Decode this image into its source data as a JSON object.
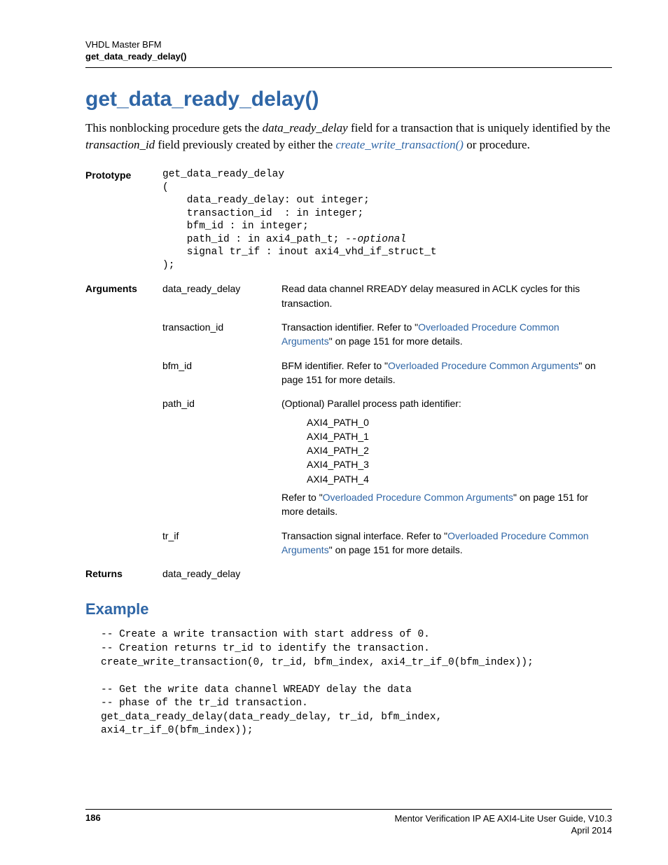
{
  "header": {
    "chapter": "VHDL Master BFM",
    "section": "get_data_ready_delay()"
  },
  "title": "get_data_ready_delay()",
  "intro": {
    "prefix": "This nonblocking procedure gets the ",
    "ital1": "data_ready_delay",
    "mid1": " field for a transaction that is uniquely identified by the ",
    "ital2": "transaction_id",
    "mid2": " field previously created by either the ",
    "link": "create_write_transaction()",
    "suffix": " or  procedure."
  },
  "labels": {
    "prototype": "Prototype",
    "arguments": "Arguments",
    "returns": "Returns",
    "example": "Example"
  },
  "prototype": "get_data_ready_delay\n(\n    data_ready_delay: out integer;\n    transaction_id  : in integer;\n    bfm_id : in integer;\n    path_id : in axi4_path_t; --optional\n    signal tr_if : inout axi4_vhd_if_struct_t\n);",
  "proto_optional_comment": "--optional",
  "args": {
    "data_ready_delay": {
      "name": "data_ready_delay",
      "desc": "Read data channel RREADY delay measured in ACLK cycles for this transaction."
    },
    "transaction_id": {
      "name": "transaction_id",
      "pre": "Transaction identifier. Refer to \"",
      "link": "Overloaded Procedure Common Arguments",
      "post": "\" on page 151 for more details."
    },
    "bfm_id": {
      "name": "bfm_id",
      "pre": "BFM identifier. Refer to \"",
      "link": "Overloaded Procedure Common Arguments",
      "post": "\" on page 151 for more details."
    },
    "path_id": {
      "name": "path_id",
      "desc1": "(Optional) Parallel process path identifier:",
      "paths": [
        "AXI4_PATH_0",
        "AXI4_PATH_1",
        "AXI4_PATH_2",
        "AXI4_PATH_3",
        "AXI4_PATH_4"
      ],
      "pre": "Refer to \"",
      "link": "Overloaded Procedure Common Arguments",
      "post": "\" on page 151 for more details."
    },
    "tr_if": {
      "name": "tr_if",
      "pre": "Transaction signal interface. Refer to \"",
      "link": "Overloaded Procedure Common Arguments",
      "post": "\" on page 151 for more details."
    }
  },
  "returns": "data_ready_delay",
  "example_code": "-- Create a write transaction with start address of 0.\n-- Creation returns tr_id to identify the transaction.\ncreate_write_transaction(0, tr_id, bfm_index, axi4_tr_if_0(bfm_index));\n\n-- Get the write data channel WREADY delay the data\n-- phase of the tr_id transaction.\nget_data_ready_delay(data_ready_delay, tr_id, bfm_index,\naxi4_tr_if_0(bfm_index));",
  "footer": {
    "page": "186",
    "doc": "Mentor Verification IP AE AXI4-Lite User Guide, V10.3",
    "date": "April 2014"
  }
}
